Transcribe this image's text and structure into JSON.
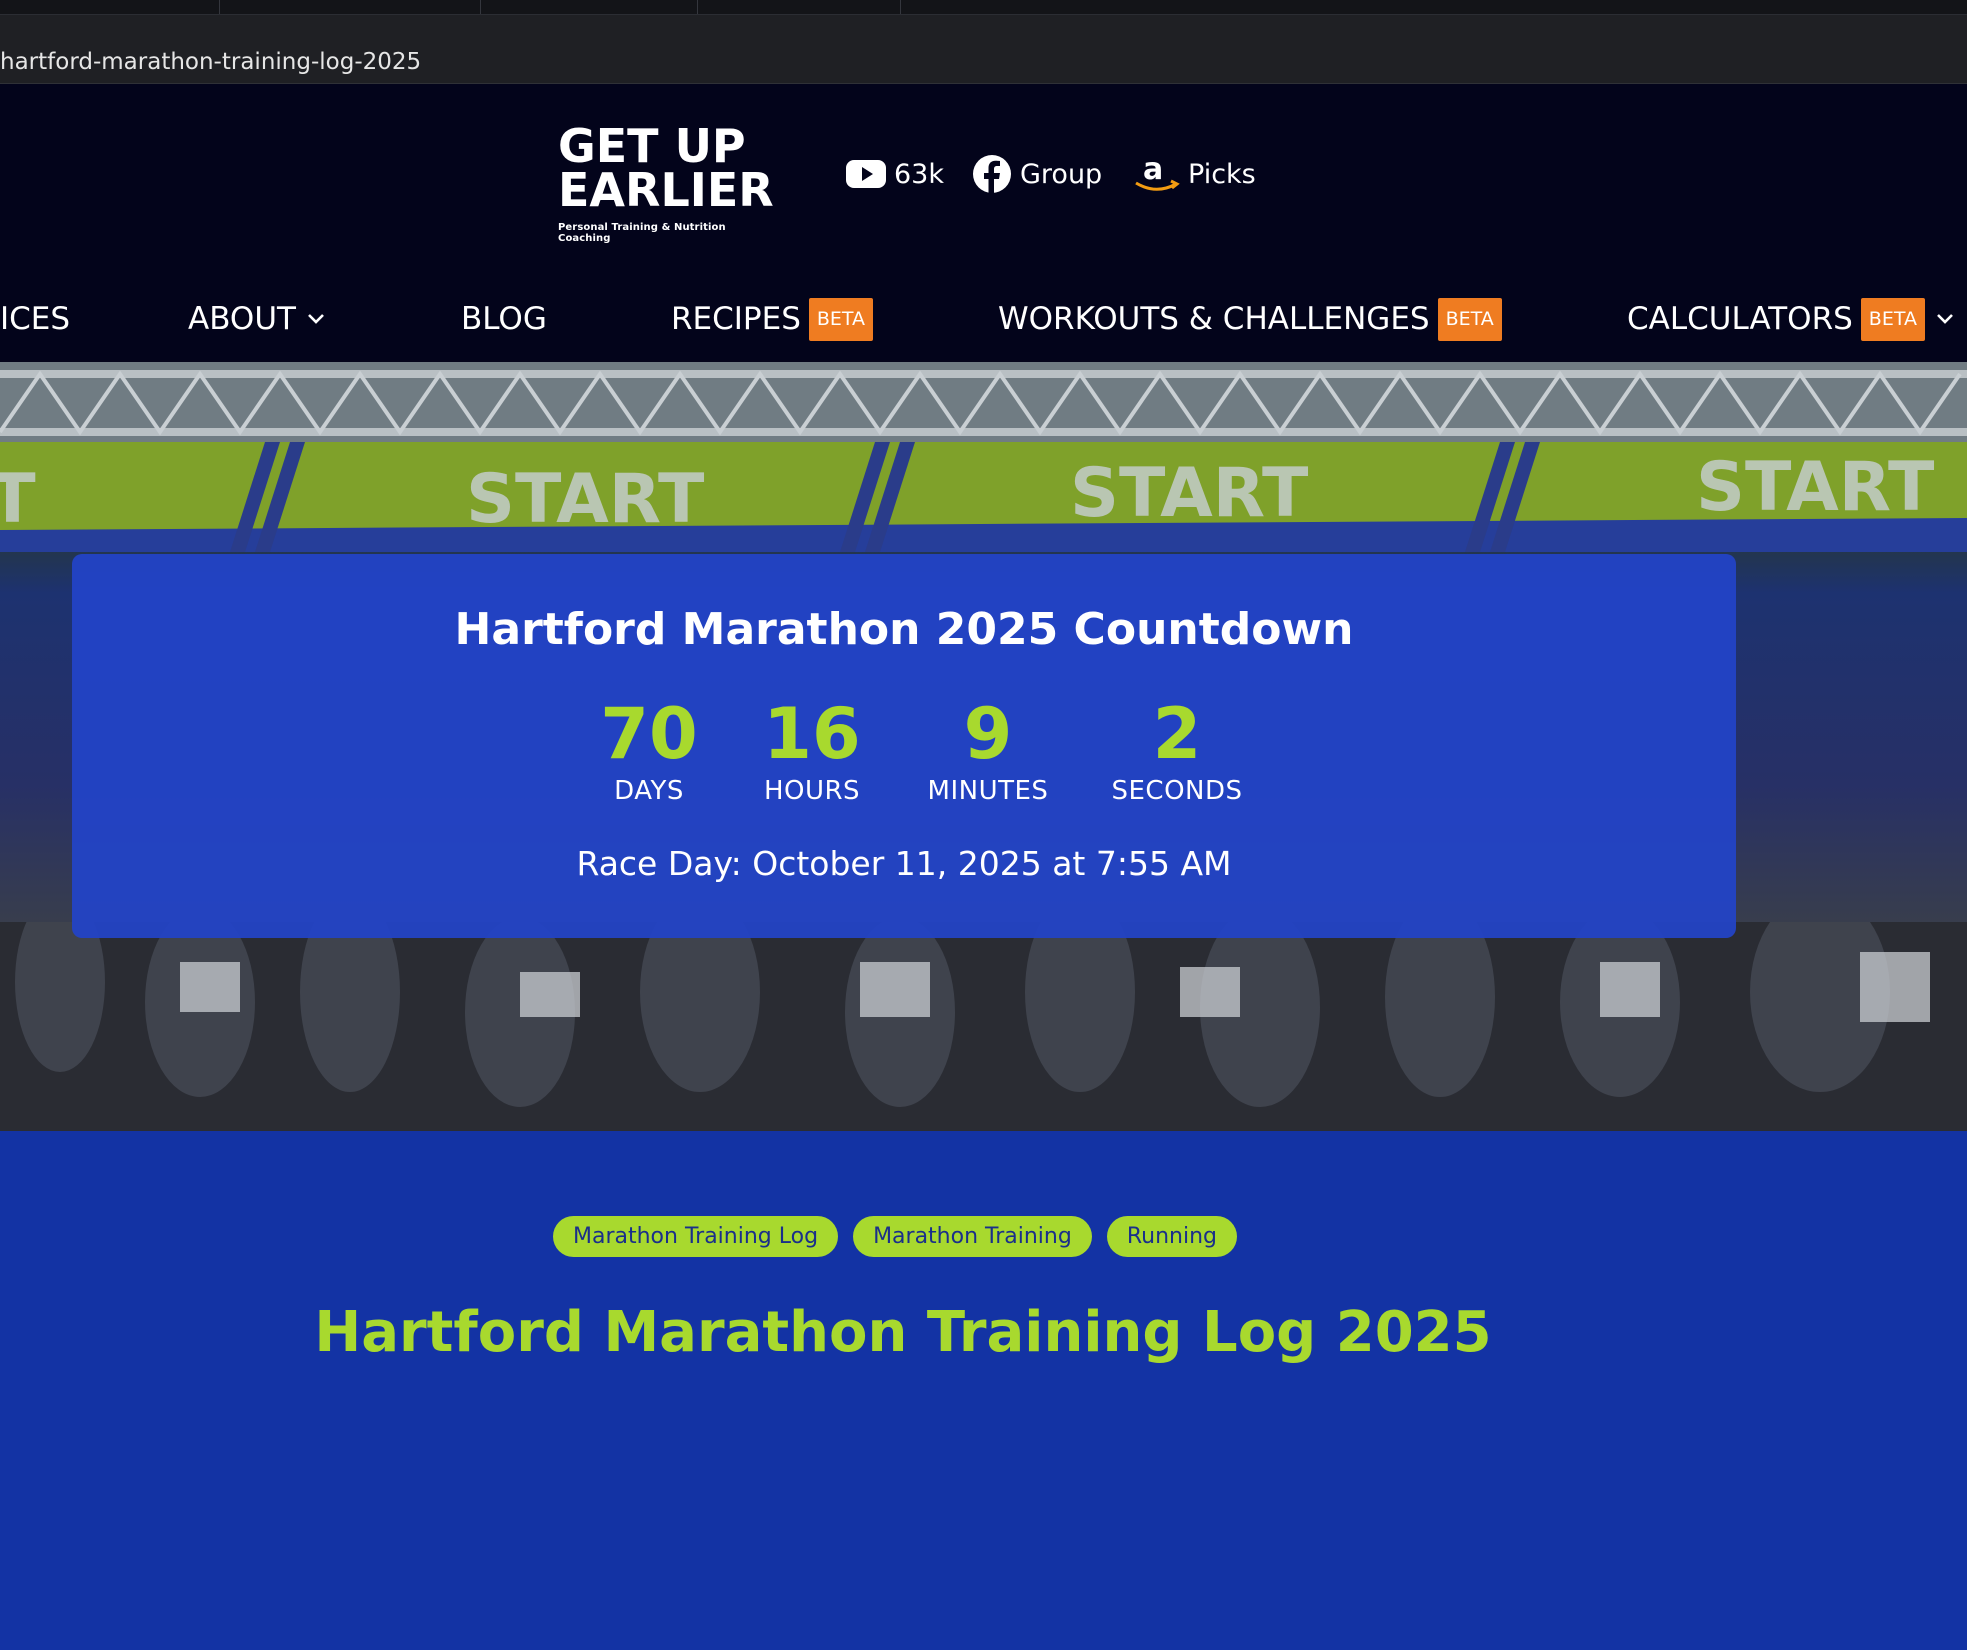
{
  "browser": {
    "url": "hartford-marathon-training-log-2025"
  },
  "header": {
    "logo_line1": "GET UP",
    "logo_line2": "EARLIER",
    "logo_tagline": "Personal Training & Nutrition Coaching",
    "youtube_count": "63k",
    "facebook_label": "Group",
    "amazon_label": "Picks"
  },
  "nav": {
    "services": "ICES",
    "about": "ABOUT",
    "blog": "BLOG",
    "recipes": "RECIPES",
    "workouts": "WORKOUTS & CHALLENGES",
    "calculators": "CALCULATORS",
    "beta": "BETA"
  },
  "hero": {
    "banner_text": "START"
  },
  "countdown": {
    "title": "Hartford Marathon 2025 Countdown",
    "days": "70",
    "days_label": "DAYS",
    "hours": "16",
    "hours_label": "HOURS",
    "minutes": "9",
    "minutes_label": "MINUTES",
    "seconds": "2",
    "seconds_label": "SECONDS",
    "race_day": "Race Day: October 11, 2025 at 7:55 AM"
  },
  "tags": [
    "Marathon Training Log",
    "Marathon Training",
    "Running"
  ],
  "page_title": "Hartford Marathon Training Log 2025",
  "colors": {
    "accent_green": "#a8d92e",
    "beta_orange": "#ef7c21",
    "page_blue": "#1333a4",
    "header_bg": "#03041b"
  }
}
